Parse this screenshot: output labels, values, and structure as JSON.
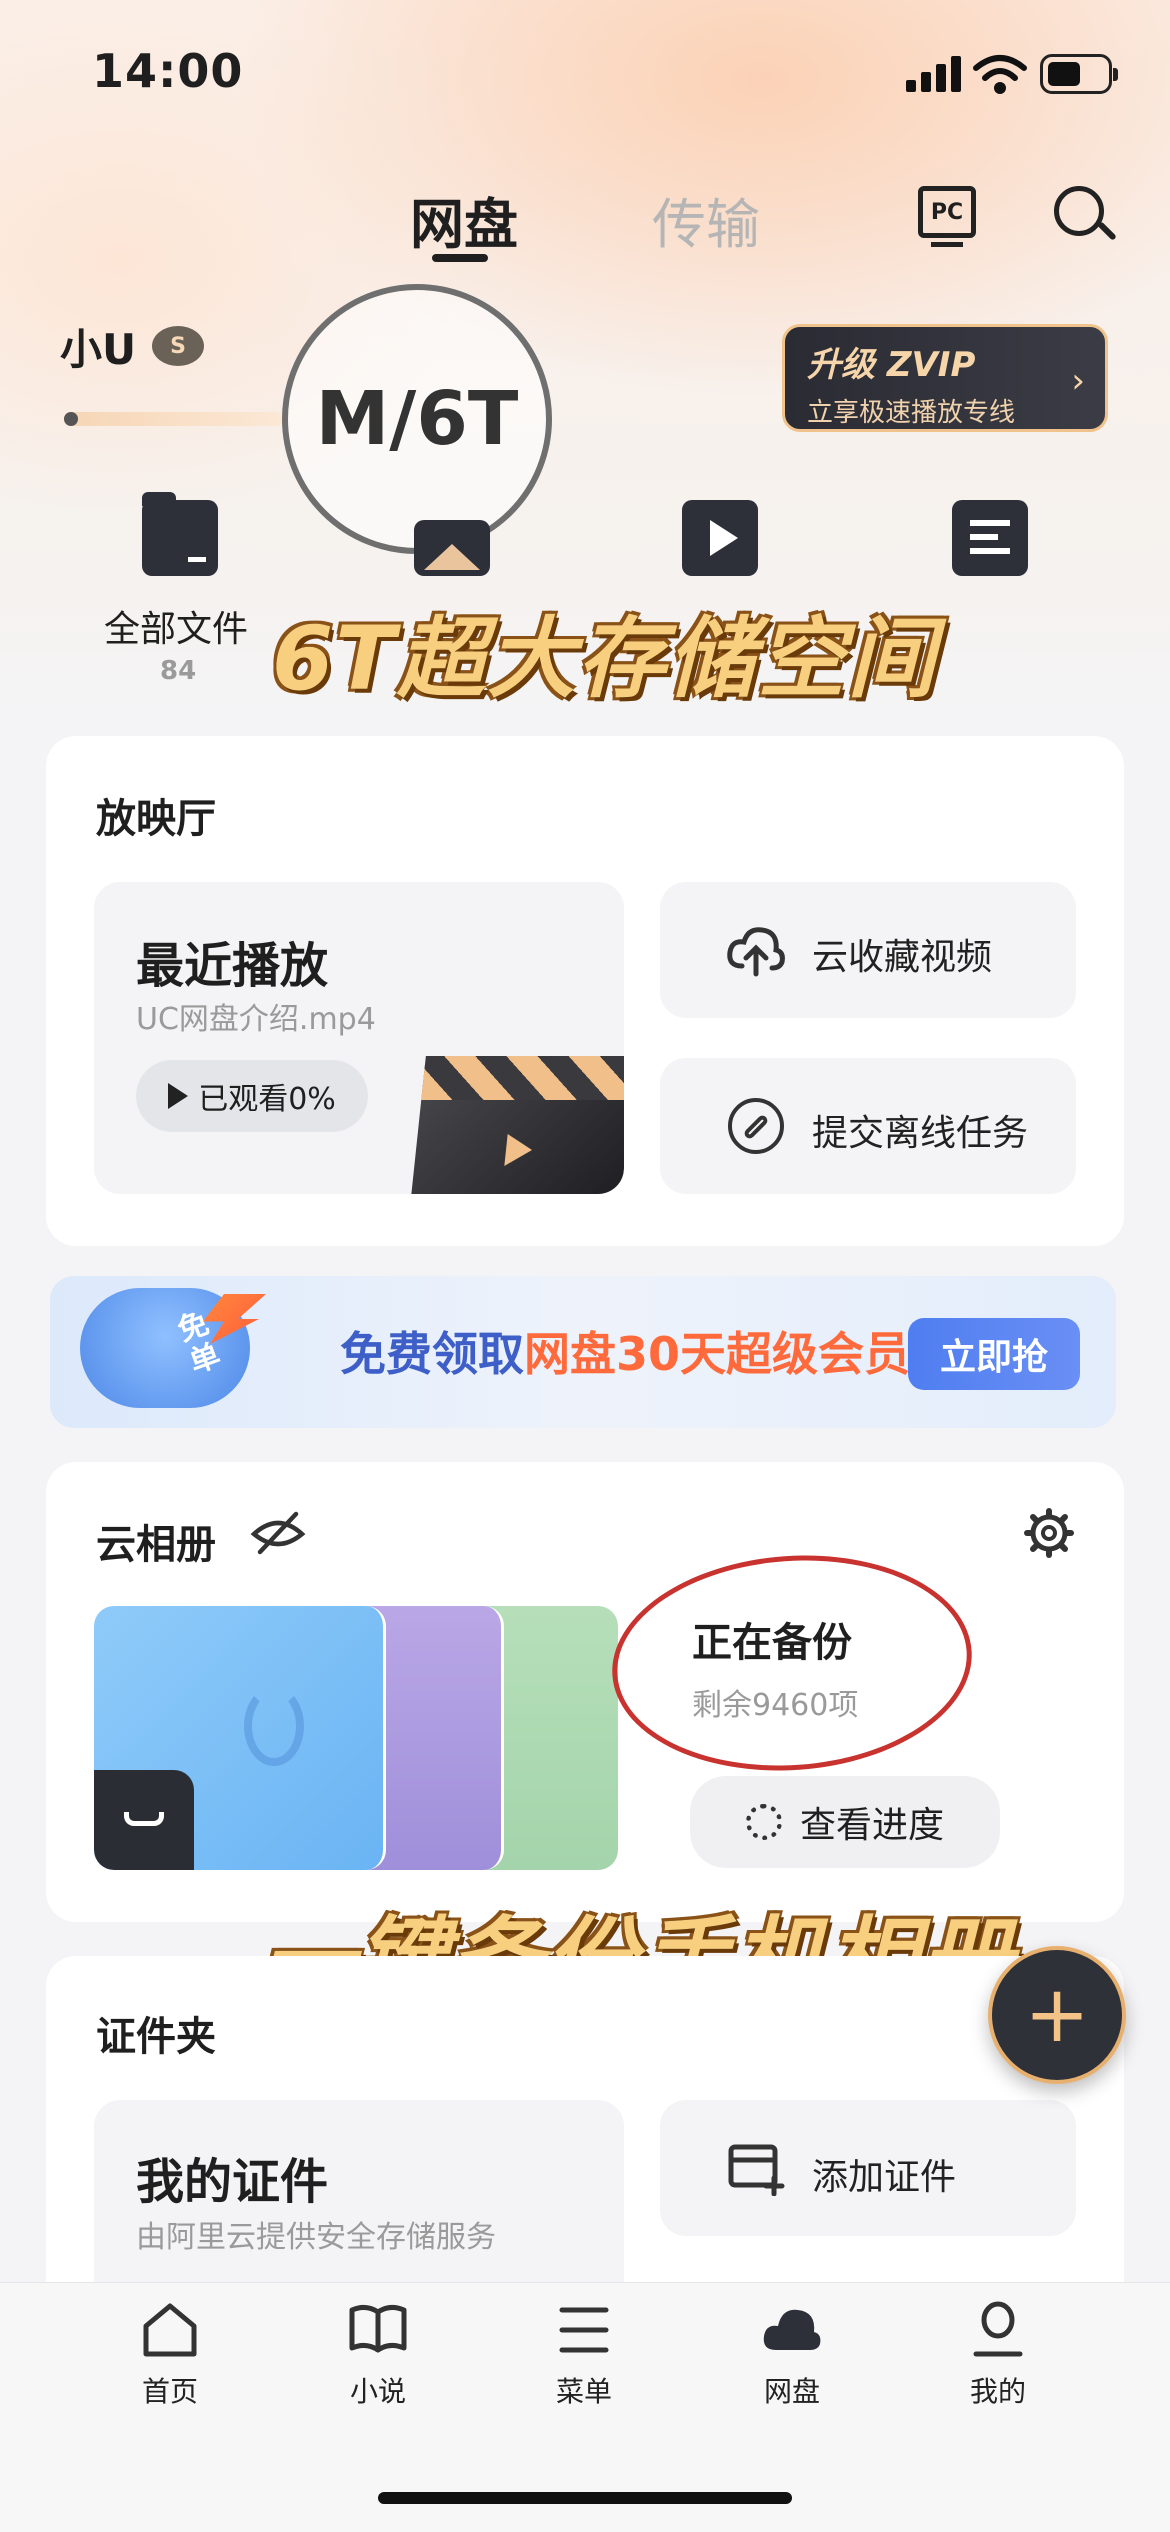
{
  "status_bar": {
    "time": "14:00"
  },
  "top_tabs": [
    {
      "label": "网盘",
      "active": true
    },
    {
      "label": "传输",
      "active": false
    }
  ],
  "header_icons": {
    "pc_label": "PC"
  },
  "user": {
    "name": "小U",
    "level_badge": "S"
  },
  "storage": {
    "magnified_text": "M/6T"
  },
  "vip_card": {
    "title": "升级 ZVIP",
    "subtitle": "立享极速播放专线",
    "chevron": "›"
  },
  "categories": [
    {
      "label": "全部文件",
      "count": "84",
      "icon": "folder-icon"
    },
    {
      "icon": "image-icon"
    },
    {
      "icon": "video-icon"
    },
    {
      "icon": "document-icon"
    }
  ],
  "promo_overlay_1": "6T超大存储空间",
  "theater": {
    "title": "放映厅",
    "recent": {
      "title": "最近播放",
      "filename": "UC网盘介绍.mp4",
      "progress_label": "已观看0%"
    },
    "actions": [
      {
        "label": "云收藏视频",
        "icon": "cloud-upload-icon"
      },
      {
        "label": "提交离线任务",
        "icon": "link-icon"
      }
    ]
  },
  "ad": {
    "text_prefix": "免费领取",
    "text_highlight": "网盘30天超级会员",
    "button": "立即抢",
    "cloud_text": "免单"
  },
  "album": {
    "title": "云相册",
    "status_title": "正在备份",
    "remaining": "剩余9460项",
    "progress_button": "查看进度"
  },
  "promo_overlay_2": "一键备份手机相册",
  "certificates": {
    "title": "证件夹",
    "card_title": "我的证件",
    "card_sub": "由阿里云提供安全存储服务",
    "add_label": "添加证件"
  },
  "fab_label": "+",
  "bottom_nav": [
    {
      "label": "首页",
      "icon": "home-icon"
    },
    {
      "label": "小说",
      "icon": "book-icon"
    },
    {
      "label": "菜单",
      "icon": "menu-icon"
    },
    {
      "label": "网盘",
      "icon": "cloud-icon",
      "active": true
    },
    {
      "label": "我的",
      "icon": "profile-icon"
    }
  ],
  "colors": {
    "accent_gold": "#f0c38c",
    "dark": "#2d3038",
    "ad_blue": "#3d5fc7"
  }
}
